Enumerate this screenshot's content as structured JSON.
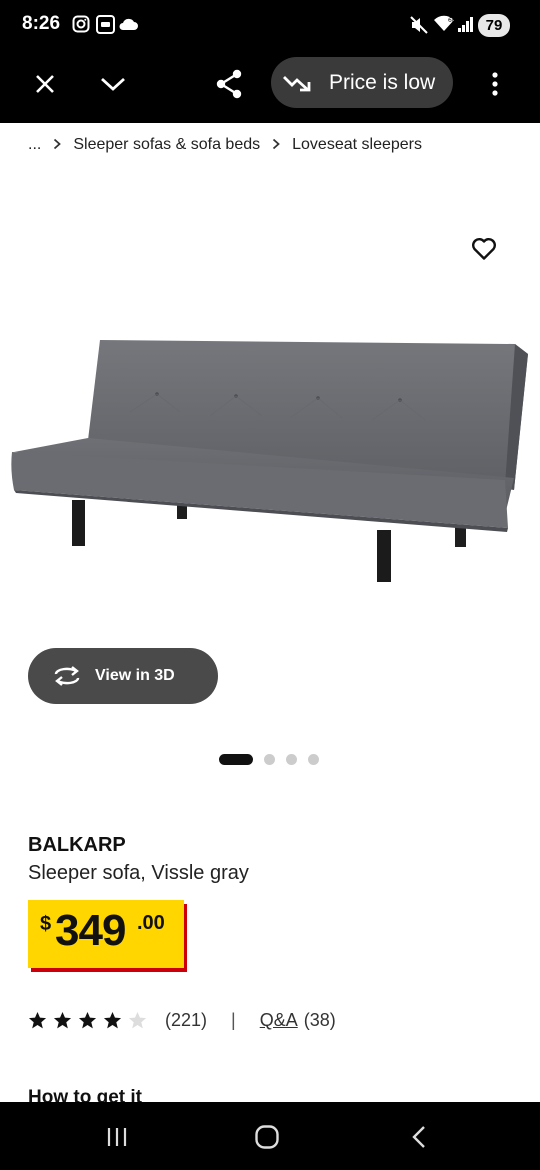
{
  "status_bar": {
    "time": "8:26",
    "battery": "79",
    "icons": [
      "instagram-icon",
      "ring-icon",
      "cloud-icon",
      "mute-icon",
      "wifi-icon",
      "signal-icon"
    ]
  },
  "toolbar": {
    "close_icon": "close-icon",
    "collapse_icon": "chevron-down-icon",
    "share_icon": "share-icon",
    "price_pill_label": "Price is low",
    "menu_icon": "more-vert-icon"
  },
  "breadcrumb": {
    "ellipsis": "...",
    "items": [
      "Sleeper sofas & sofa beds",
      "Loveseat sleepers"
    ]
  },
  "gallery": {
    "view3d_label": "View in 3D",
    "dot_count": 4,
    "active_index": 0
  },
  "product": {
    "name": "BALKARP",
    "description": "Sleeper sofa, Vissle gray",
    "price_currency": "$",
    "price_whole": "349",
    "price_decimal": ".00",
    "rating": 4,
    "rating_max": 5,
    "review_count": "(221)",
    "separator": "|",
    "qa_label": "Q&A",
    "qa_count": "(38)"
  },
  "sections": {
    "how_to_get": "How to get it"
  },
  "colors": {
    "price_bg": "#ffd600",
    "price_shadow": "#cc0008",
    "sofa": "#6b6d72",
    "chrome": "#000000"
  }
}
